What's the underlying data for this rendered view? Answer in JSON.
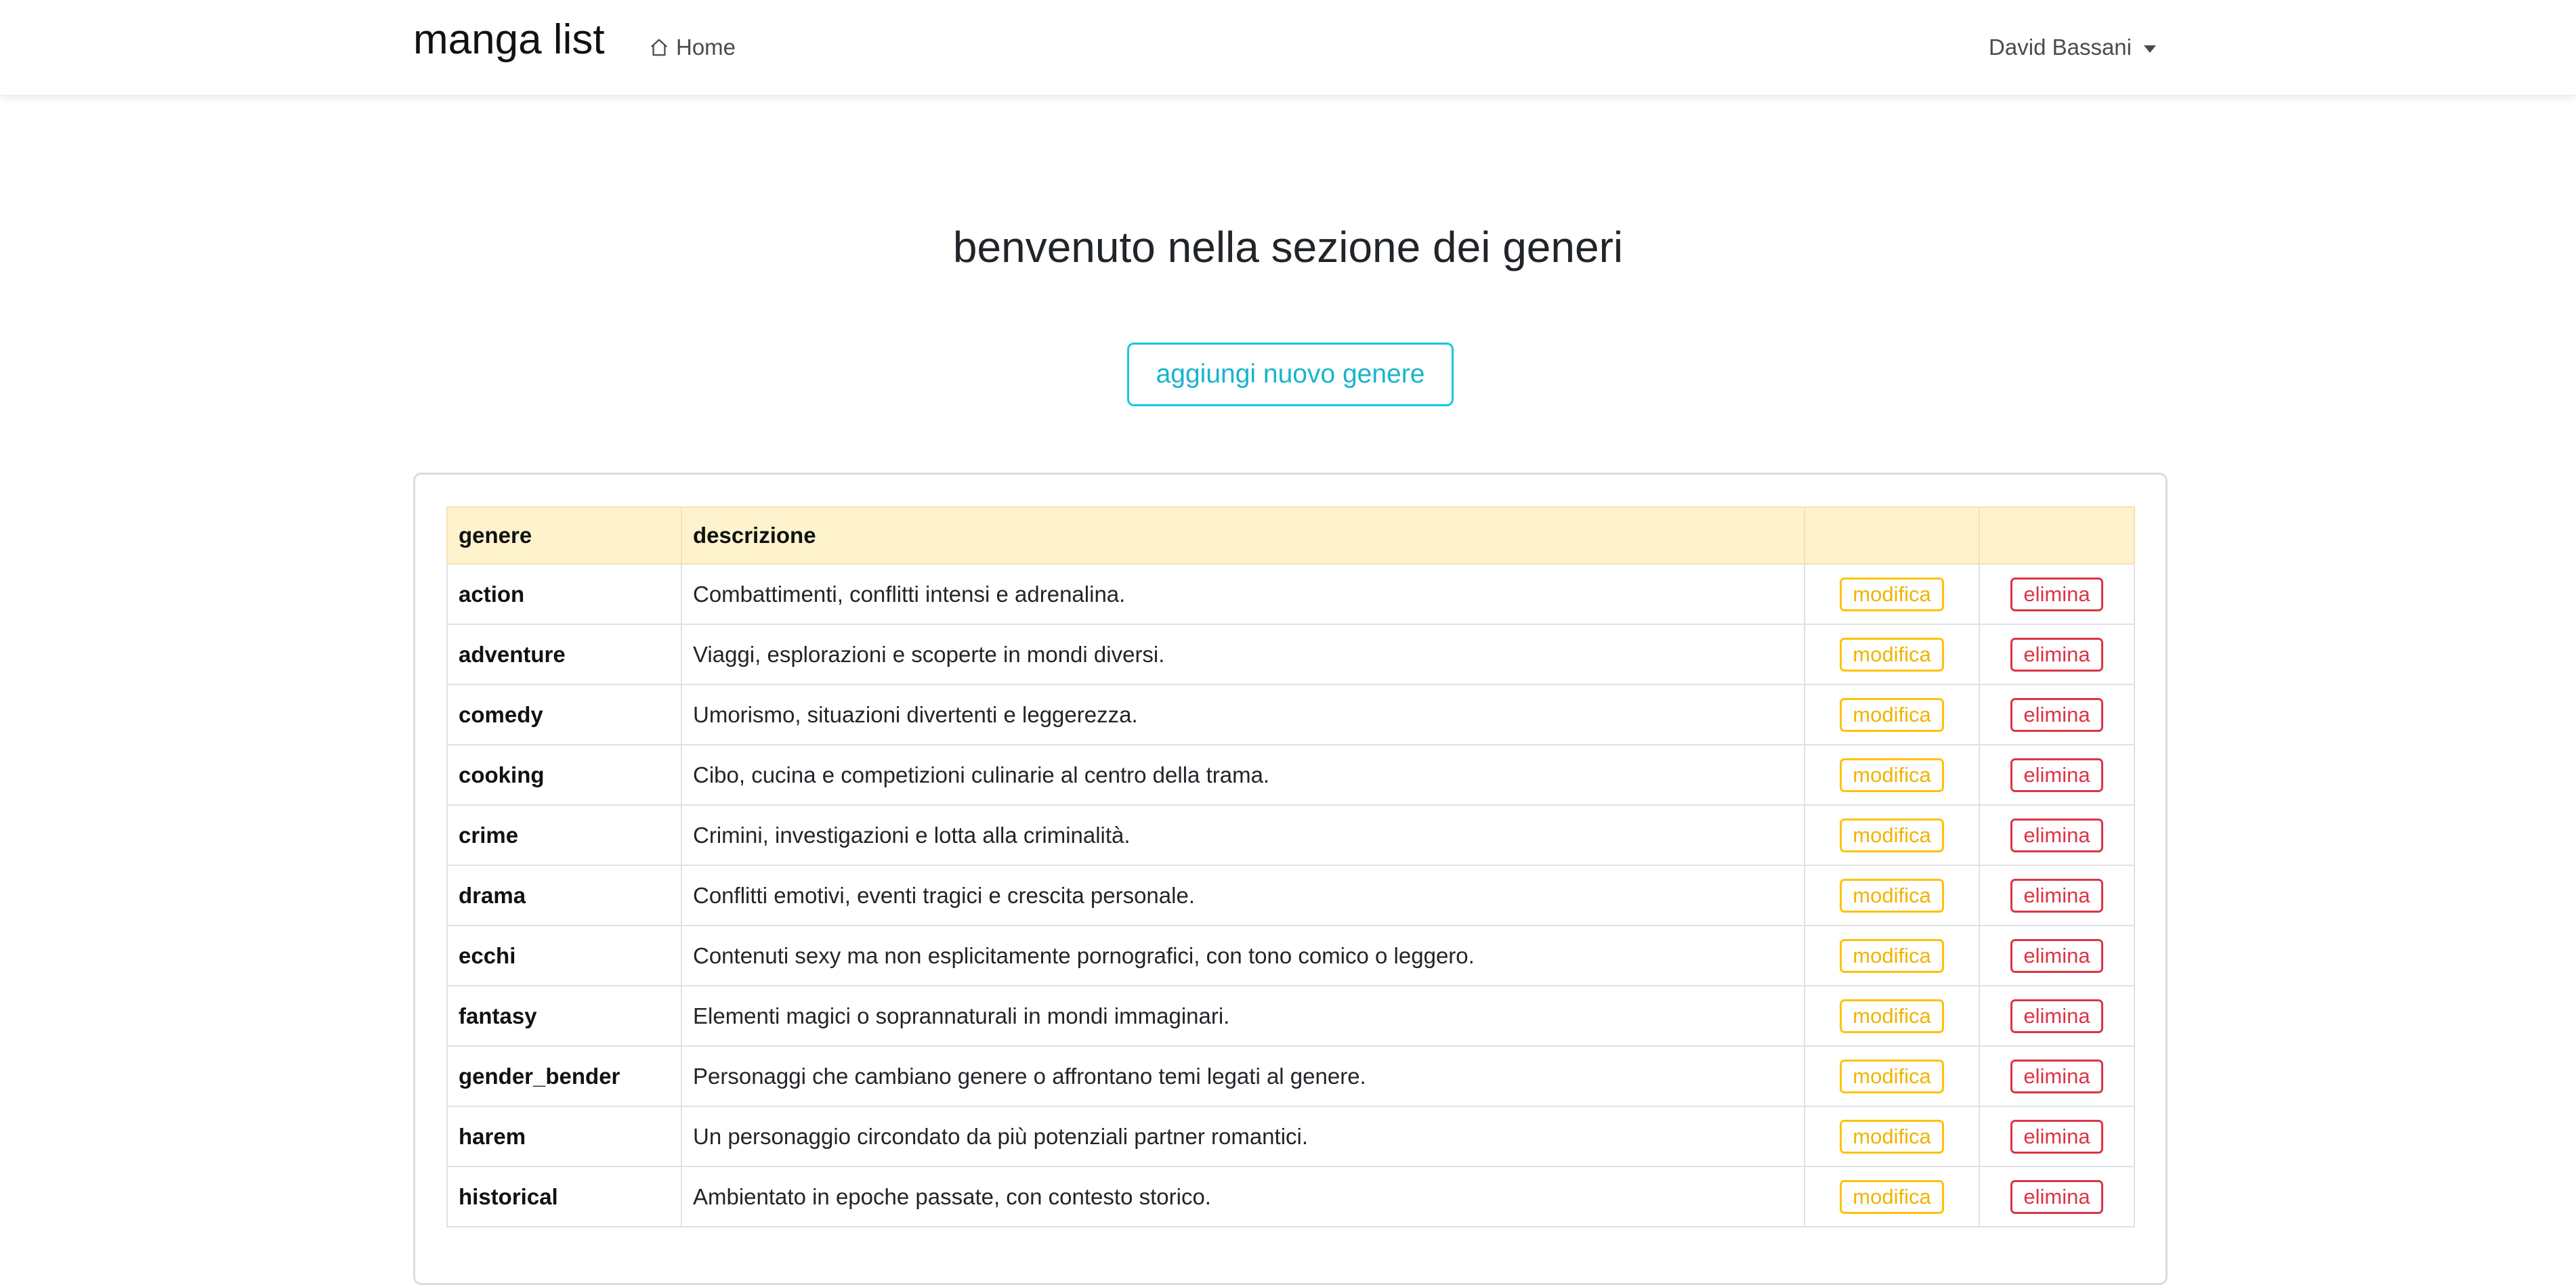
{
  "navbar": {
    "brand": "manga list",
    "home_label": "Home",
    "home_icon": "home-icon",
    "user_name": "David Bassani",
    "user_caret_icon": "caret-down-icon"
  },
  "main": {
    "title": "benvenuto nella sezione dei generi",
    "add_button_label": "aggiungi nuovo genere"
  },
  "colors": {
    "accent_info": "#17c7e0",
    "warning": "#ffc107",
    "danger": "#dc3545",
    "table_header_bg": "#fff3cd"
  },
  "table": {
    "headers": [
      "genere",
      "descrizione",
      "",
      ""
    ],
    "edit_label": "modifica",
    "delete_label": "elimina",
    "rows": [
      {
        "genre": "action",
        "description": "Combattimenti, conflitti intensi e adrenalina."
      },
      {
        "genre": "adventure",
        "description": "Viaggi, esplorazioni e scoperte in mondi diversi."
      },
      {
        "genre": "comedy",
        "description": "Umorismo, situazioni divertenti e leggerezza."
      },
      {
        "genre": "cooking",
        "description": "Cibo, cucina e competizioni culinarie al centro della trama."
      },
      {
        "genre": "crime",
        "description": "Crimini, investigazioni e lotta alla criminalità."
      },
      {
        "genre": "drama",
        "description": "Conflitti emotivi, eventi tragici e crescita personale."
      },
      {
        "genre": "ecchi",
        "description": "Contenuti sexy ma non esplicitamente pornografici, con tono comico o leggero."
      },
      {
        "genre": "fantasy",
        "description": "Elementi magici o soprannaturali in mondi immaginari."
      },
      {
        "genre": "gender_bender",
        "description": "Personaggi che cambiano genere o affrontano temi legati al genere."
      },
      {
        "genre": "harem",
        "description": "Un personaggio circondato da più potenziali partner romantici."
      },
      {
        "genre": "historical",
        "description": "Ambientato in epoche passate, con contesto storico."
      }
    ]
  }
}
